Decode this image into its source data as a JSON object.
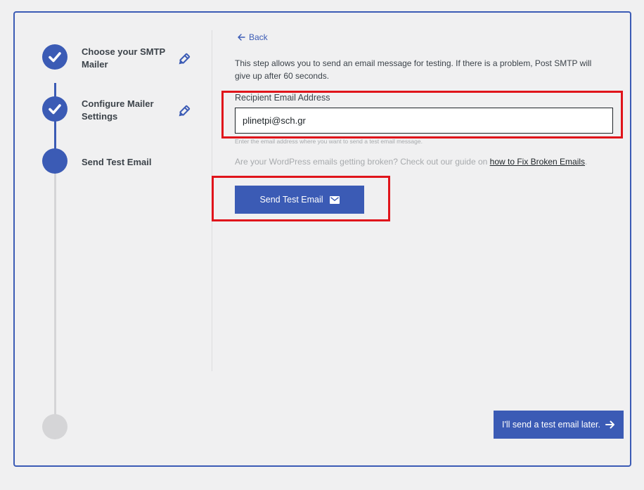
{
  "steps": [
    {
      "label": "Choose your SMTP Mailer",
      "state": "done",
      "icon": "checkmark-icon"
    },
    {
      "label": "Configure Mailer Settings",
      "state": "done",
      "icon": "checkmark-icon"
    },
    {
      "label": "Send Test Email",
      "state": "current"
    },
    {
      "label": "",
      "state": "pending"
    }
  ],
  "back": {
    "label": "Back",
    "icon": "arrow-left-icon"
  },
  "intro": "This step allows you to send an email message for testing. If there is a problem, Post SMTP will give up after 60 seconds.",
  "recipient": {
    "label": "Recipient Email Address",
    "value": "plinetpi@sch.gr",
    "help": "Enter the email address where you want to send a test email message."
  },
  "guide": {
    "prefix": "Are your WordPress emails getting broken? Check out our guide on ",
    "link": "how to Fix Broken Emails",
    "suffix": "."
  },
  "send_button": {
    "label": "Send Test Email",
    "icon": "envelope-icon"
  },
  "later_button": {
    "label": "I'll send a test email later.",
    "icon": "arrow-right-icon"
  },
  "colors": {
    "accent": "#3b5bb5",
    "idle": "#d5d5d7",
    "highlight": "#e0141b",
    "background": "#f0f0f1"
  }
}
